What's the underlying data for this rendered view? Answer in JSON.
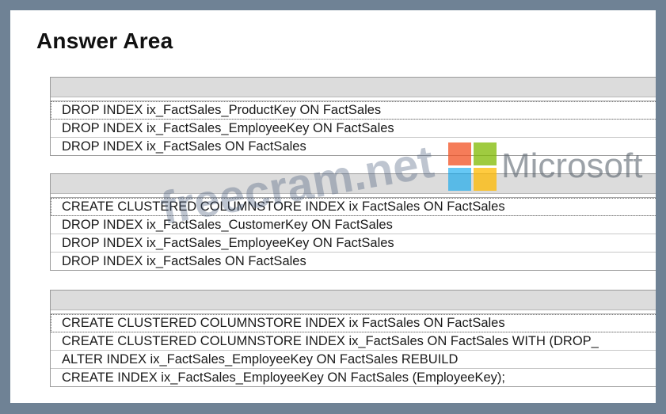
{
  "title": "Answer Area",
  "boxes": [
    {
      "options": [
        "DROP INDEX ix_FactSales_ProductKey ON FactSales",
        "DROP INDEX ix_FactSales_EmployeeKey ON FactSales",
        "DROP INDEX ix_FactSales ON FactSales"
      ]
    },
    {
      "options": [
        "CREATE CLUSTERED COLUMNSTORE INDEX ix FactSales ON FactSales",
        "DROP INDEX ix_FactSales_CustomerKey ON FactSales",
        "DROP INDEX ix_FactSales_EmployeeKey ON FactSales",
        "DROP INDEX ix_FactSales ON FactSales"
      ]
    },
    {
      "options": [
        "CREATE CLUSTERED COLUMNSTORE INDEX ix FactSales ON FactSales",
        "CREATE CLUSTERED COLUMNSTORE INDEX ix_FactSales ON FactSales WITH (DROP_",
        "ALTER INDEX ix_FactSales_EmployeeKey ON FactSales REBUILD",
        "CREATE INDEX ix_FactSales_EmployeeKey ON FactSales (EmployeeKey);"
      ]
    }
  ],
  "watermark": {
    "site": "freecram.net",
    "brand": "Microsoft"
  },
  "colors": {
    "frame": "#6f8295",
    "header_bar": "#dcdcdc"
  }
}
